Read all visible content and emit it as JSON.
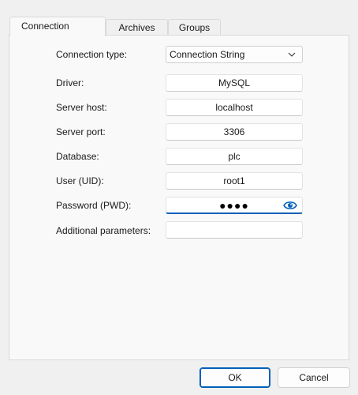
{
  "tabs": [
    {
      "label": "Connection",
      "active": true
    },
    {
      "label": "Archives",
      "active": false
    },
    {
      "label": "Groups",
      "active": false
    }
  ],
  "form": {
    "connection_type": {
      "label": "Connection type:",
      "value": "Connection String"
    },
    "driver": {
      "label": "Driver:",
      "value": "MySQL"
    },
    "server_host": {
      "label": "Server host:",
      "value": "localhost"
    },
    "server_port": {
      "label": "Server port:",
      "value": "3306"
    },
    "database": {
      "label": "Database:",
      "value": "plc"
    },
    "user": {
      "label": "User (UID):",
      "value": "root1"
    },
    "password": {
      "label": "Password (PWD):",
      "value": "●●●●",
      "icon": "eye-icon"
    },
    "additional": {
      "label": "Additional parameters:",
      "value": ""
    }
  },
  "buttons": {
    "ok": "OK",
    "cancel": "Cancel"
  },
  "colors": {
    "accent": "#005fb8",
    "background": "#f0f0f0",
    "panel": "#f9f9f9"
  }
}
